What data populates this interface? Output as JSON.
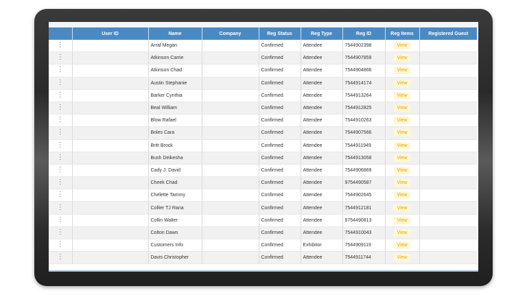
{
  "table": {
    "columns": [
      "",
      "User ID",
      "Name",
      "Company",
      "Reg Status",
      "Reg Type",
      "Reg ID",
      "Reg Items",
      "Registered Guest"
    ],
    "view_label": "View",
    "rows": [
      {
        "user_id": "",
        "name": "Arraf Megan",
        "company": "",
        "status": "Confirmed",
        "type": "Attendee",
        "reg_id": "7544902398",
        "guest": ""
      },
      {
        "user_id": "",
        "name": "Atkinson Carrie",
        "company": "",
        "status": "Confirmed",
        "type": "Attendee",
        "reg_id": "7544907859",
        "guest": ""
      },
      {
        "user_id": "",
        "name": "Atkinson Chad",
        "company": "",
        "status": "Confirmed",
        "type": "Attendee",
        "reg_id": "7544904866",
        "guest": ""
      },
      {
        "user_id": "",
        "name": "Austin Stephanie",
        "company": "",
        "status": "Confirmed",
        "type": "Attendee",
        "reg_id": "7544914174",
        "guest": ""
      },
      {
        "user_id": "",
        "name": "Barker Cynthia",
        "company": "",
        "status": "Confirmed",
        "type": "Attendee",
        "reg_id": "7544913264",
        "guest": ""
      },
      {
        "user_id": "",
        "name": "Beal William",
        "company": "",
        "status": "Confirmed",
        "type": "Attendee",
        "reg_id": "7544912825",
        "guest": ""
      },
      {
        "user_id": "",
        "name": "Blow Rafael",
        "company": "",
        "status": "Confirmed",
        "type": "Attendee",
        "reg_id": "7544910263",
        "guest": ""
      },
      {
        "user_id": "",
        "name": "Boles Cara",
        "company": "",
        "status": "Confirmed",
        "type": "Attendee",
        "reg_id": "7544907566",
        "guest": ""
      },
      {
        "user_id": "",
        "name": "Britt Brock",
        "company": "",
        "status": "Confirmed",
        "type": "Attendee",
        "reg_id": "7544911949",
        "guest": ""
      },
      {
        "user_id": "",
        "name": "Bush Deikesha",
        "company": "",
        "status": "Confirmed",
        "type": "Attendee",
        "reg_id": "7544913058",
        "guest": ""
      },
      {
        "user_id": "",
        "name": "Cady J. David",
        "company": "",
        "status": "Confirmed",
        "type": "Attendee",
        "reg_id": "7544906869",
        "guest": ""
      },
      {
        "user_id": "",
        "name": "Cheek Chad",
        "company": "",
        "status": "Confirmed",
        "type": "Attendee",
        "reg_id": "9754490587",
        "guest": ""
      },
      {
        "user_id": "",
        "name": "Chelette Tammy",
        "company": "",
        "status": "Confirmed",
        "type": "Attendee",
        "reg_id": "7544902645",
        "guest": ""
      },
      {
        "user_id": "",
        "name": "Collier TJ Rana",
        "company": "",
        "status": "Confirmed",
        "type": "Attendee",
        "reg_id": "7544912181",
        "guest": ""
      },
      {
        "user_id": "",
        "name": "Collin Walter",
        "company": "",
        "status": "Confirmed",
        "type": "Attendee",
        "reg_id": "9754490813",
        "guest": ""
      },
      {
        "user_id": "",
        "name": "Colton Dawn",
        "company": "",
        "status": "Confirmed",
        "type": "Attendee",
        "reg_id": "7544910043",
        "guest": ""
      },
      {
        "user_id": "",
        "name": "Customers Info",
        "company": "",
        "status": "Confirmed",
        "type": "Exhibitor",
        "reg_id": "7544909119",
        "guest": ""
      },
      {
        "user_id": "",
        "name": "Davis Christopher",
        "company": "",
        "status": "Confirmed",
        "type": "Attendee",
        "reg_id": "7544911744",
        "guest": ""
      }
    ]
  },
  "colors": {
    "header_bg": "#4a8ac4",
    "view_text": "#e0a800",
    "view_bg": "#fff7d6"
  }
}
